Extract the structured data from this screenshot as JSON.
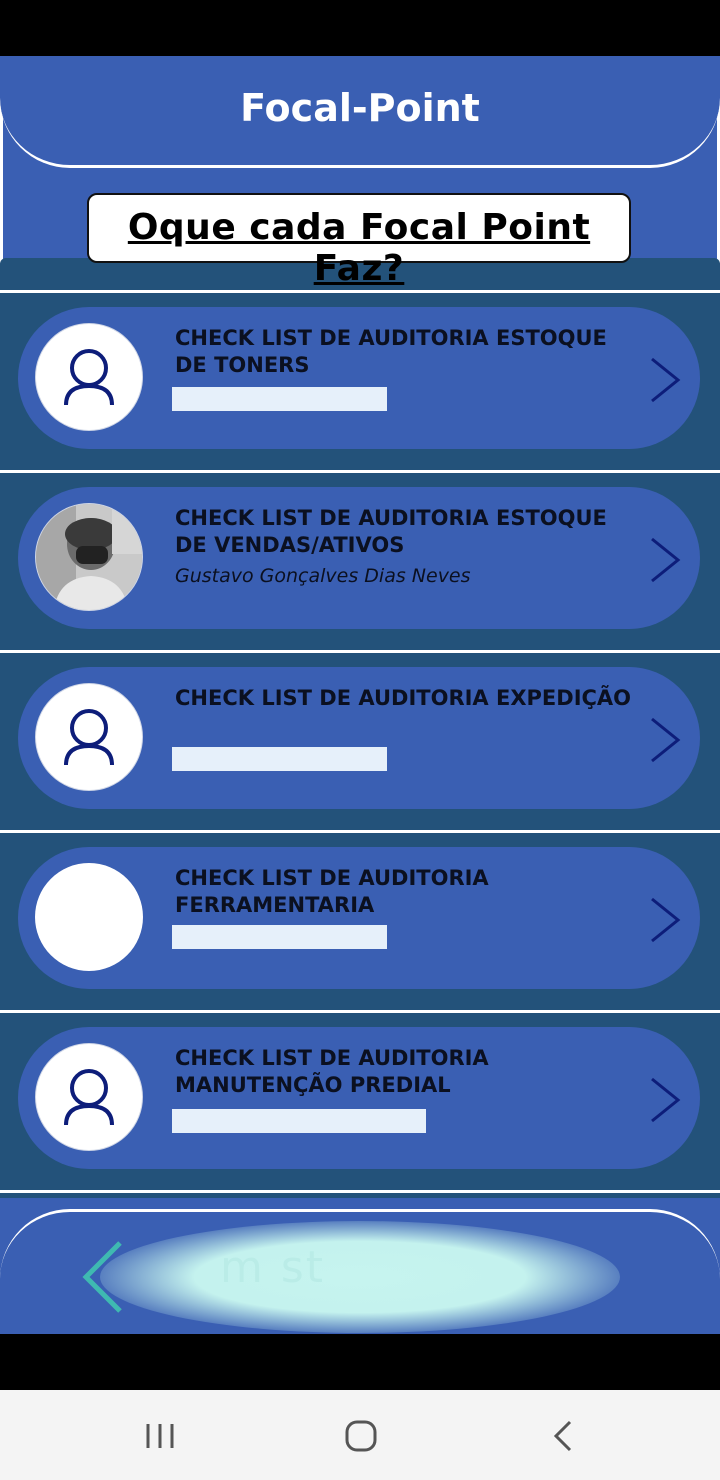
{
  "app": {
    "title": "Focal-Point",
    "question_button": "Oque cada Focal Point Faz?"
  },
  "list": {
    "items": [
      {
        "title": "CHECK LIST DE AUDITORIA ESTOQUE DE TONERS",
        "subtitle": "",
        "avatar": "user-icon"
      },
      {
        "title": "CHECK LIST DE AUDITORIA ESTOQUE DE VENDAS/ATIVOS",
        "subtitle": "Gustavo Gonçalves Dias Neves",
        "avatar": "profile-photo"
      },
      {
        "title": "CHECK LIST DE AUDITORIA EXPEDIÇÃO",
        "subtitle": "",
        "avatar": "user-icon"
      },
      {
        "title": "CHECK LIST DE AUDITORIA FERRAMENTARIA",
        "subtitle": "",
        "avatar": "blank"
      },
      {
        "title": "CHECK LIST DE AUDITORIA MANUTENÇÃO PREDIAL",
        "subtitle": "",
        "avatar": "user-icon"
      }
    ]
  },
  "bottom": {
    "ghost_text": "m      st"
  },
  "nav": {
    "recent": "recent-apps-icon",
    "home": "home-icon",
    "back": "back-icon"
  },
  "colors": {
    "primary": "#3a5fb3",
    "list_bg": "#23527a",
    "glow": "#c6f4ef",
    "chevron": "#0d1d7a"
  }
}
